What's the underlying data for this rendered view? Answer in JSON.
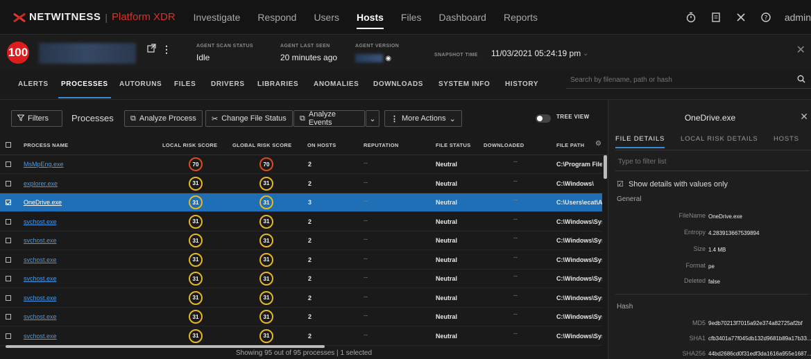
{
  "brand": {
    "name": "NETWITNESS",
    "separator": "|",
    "product": "Platform XDR"
  },
  "nav": {
    "links": [
      "Investigate",
      "Respond",
      "Users",
      "Hosts",
      "Files",
      "Dashboard",
      "Reports"
    ],
    "active": "Hosts",
    "icons": [
      "timer-icon",
      "notepad-icon",
      "tools-icon",
      "help-icon"
    ],
    "user": "admin"
  },
  "host": {
    "risk_score": "100",
    "agent_scan_status_label": "AGENT SCAN STATUS",
    "agent_scan_status": "Idle",
    "agent_last_seen_label": "AGENT LAST SEEN",
    "agent_last_seen": "20 minutes ago",
    "agent_version_label": "AGENT VERSION",
    "snapshot_label": "SNAPSHOT TIME",
    "snapshot_time": "11/03/2021 05:24:19 pm"
  },
  "tabs": [
    "ALERTS",
    "PROCESSES",
    "AUTORUNS",
    "FILES",
    "DRIVERS",
    "LIBRARIES",
    "ANOMALIES",
    "DOWNLOADS",
    "SYSTEM INFO",
    "HISTORY"
  ],
  "active_tab": "PROCESSES",
  "search": {
    "placeholder": "Search by filename, path or hash"
  },
  "toolbar": {
    "filters": "Filters",
    "title": "Processes",
    "analyze_process": "Analyze Process",
    "change_file_status": "Change File Status",
    "analyze_events": "Analyze Events",
    "more_actions": "More Actions",
    "tree_view": "TREE VIEW"
  },
  "table": {
    "columns": [
      "PROCESS NAME",
      "LOCAL RISK SCORE",
      "GLOBAL RISK SCORE",
      "ON HOSTS",
      "REPUTATION",
      "FILE STATUS",
      "DOWNLOADED",
      "FILE PATH"
    ],
    "rows": [
      {
        "name": "MsMpEng.exe",
        "local": "70",
        "global": "70",
        "hosts": "2",
        "reputation": "--",
        "status": "Neutral",
        "downloaded": "--",
        "path": "C:\\Program Files\\",
        "selected": false
      },
      {
        "name": "explorer.exe",
        "local": "31",
        "global": "31",
        "hosts": "2",
        "reputation": "--",
        "status": "Neutral",
        "downloaded": "--",
        "path": "C:\\Windows\\",
        "selected": false
      },
      {
        "name": "OneDrive.exe",
        "local": "31",
        "global": "31",
        "hosts": "3",
        "reputation": "--",
        "status": "Neutral",
        "downloaded": "--",
        "path": "C:\\Users\\ecat\\Ap",
        "selected": true
      },
      {
        "name": "svchost.exe",
        "local": "31",
        "global": "31",
        "hosts": "2",
        "reputation": "--",
        "status": "Neutral",
        "downloaded": "--",
        "path": "C:\\Windows\\Syst",
        "selected": false
      },
      {
        "name": "svchost.exe",
        "local": "31",
        "global": "31",
        "hosts": "2",
        "reputation": "--",
        "status": "Neutral",
        "downloaded": "--",
        "path": "C:\\Windows\\Syst",
        "selected": false
      },
      {
        "name": "svchost.exe",
        "local": "31",
        "global": "31",
        "hosts": "2",
        "reputation": "--",
        "status": "Neutral",
        "downloaded": "--",
        "path": "C:\\Windows\\Syst",
        "selected": false
      },
      {
        "name": "svchost.exe",
        "local": "31",
        "global": "31",
        "hosts": "2",
        "reputation": "--",
        "status": "Neutral",
        "downloaded": "--",
        "path": "C:\\Windows\\Syst",
        "selected": false
      },
      {
        "name": "svchost.exe",
        "local": "31",
        "global": "31",
        "hosts": "2",
        "reputation": "--",
        "status": "Neutral",
        "downloaded": "--",
        "path": "C:\\Windows\\Syst",
        "selected": false
      },
      {
        "name": "svchost.exe",
        "local": "31",
        "global": "31",
        "hosts": "2",
        "reputation": "--",
        "status": "Neutral",
        "downloaded": "--",
        "path": "C:\\Windows\\Syst",
        "selected": false
      },
      {
        "name": "svchost.exe",
        "local": "31",
        "global": "31",
        "hosts": "2",
        "reputation": "--",
        "status": "Neutral",
        "downloaded": "--",
        "path": "C:\\Windows\\Syst",
        "selected": false
      }
    ],
    "footer": "Showing 95 out of 95 processes | 1 selected"
  },
  "panel": {
    "title": "OneDrive.exe",
    "tabs": [
      "FILE DETAILS",
      "LOCAL RISK DETAILS",
      "HOSTS"
    ],
    "filter_placeholder": "Type to filter list",
    "show_values_only": "Show details with values only",
    "general_label": "General",
    "general": [
      {
        "key": "FileName",
        "value": "OneDrive.exe"
      },
      {
        "key": "Entropy",
        "value": "4.283913667539894"
      },
      {
        "key": "Size",
        "value": "1.4 MB"
      },
      {
        "key": "Format",
        "value": "pe"
      },
      {
        "key": "Deleted",
        "value": "false"
      }
    ],
    "hash_label": "Hash",
    "hash": [
      {
        "key": "MD5",
        "value": "9edb70213f7015a92e374a82725af2bf"
      },
      {
        "key": "SHA1",
        "value": "cfb3401a77f045db132d9681b89a17b33..."
      },
      {
        "key": "SHA256",
        "value": "44bd2686cd0f31edf3da1616a955e1687..."
      }
    ]
  },
  "colors": {
    "accent": "#1e6fb6",
    "risk_high": "#e04a1e",
    "risk_medium": "#e6b91e",
    "critical": "#dd1d1d",
    "brand_red": "#d3342c"
  }
}
